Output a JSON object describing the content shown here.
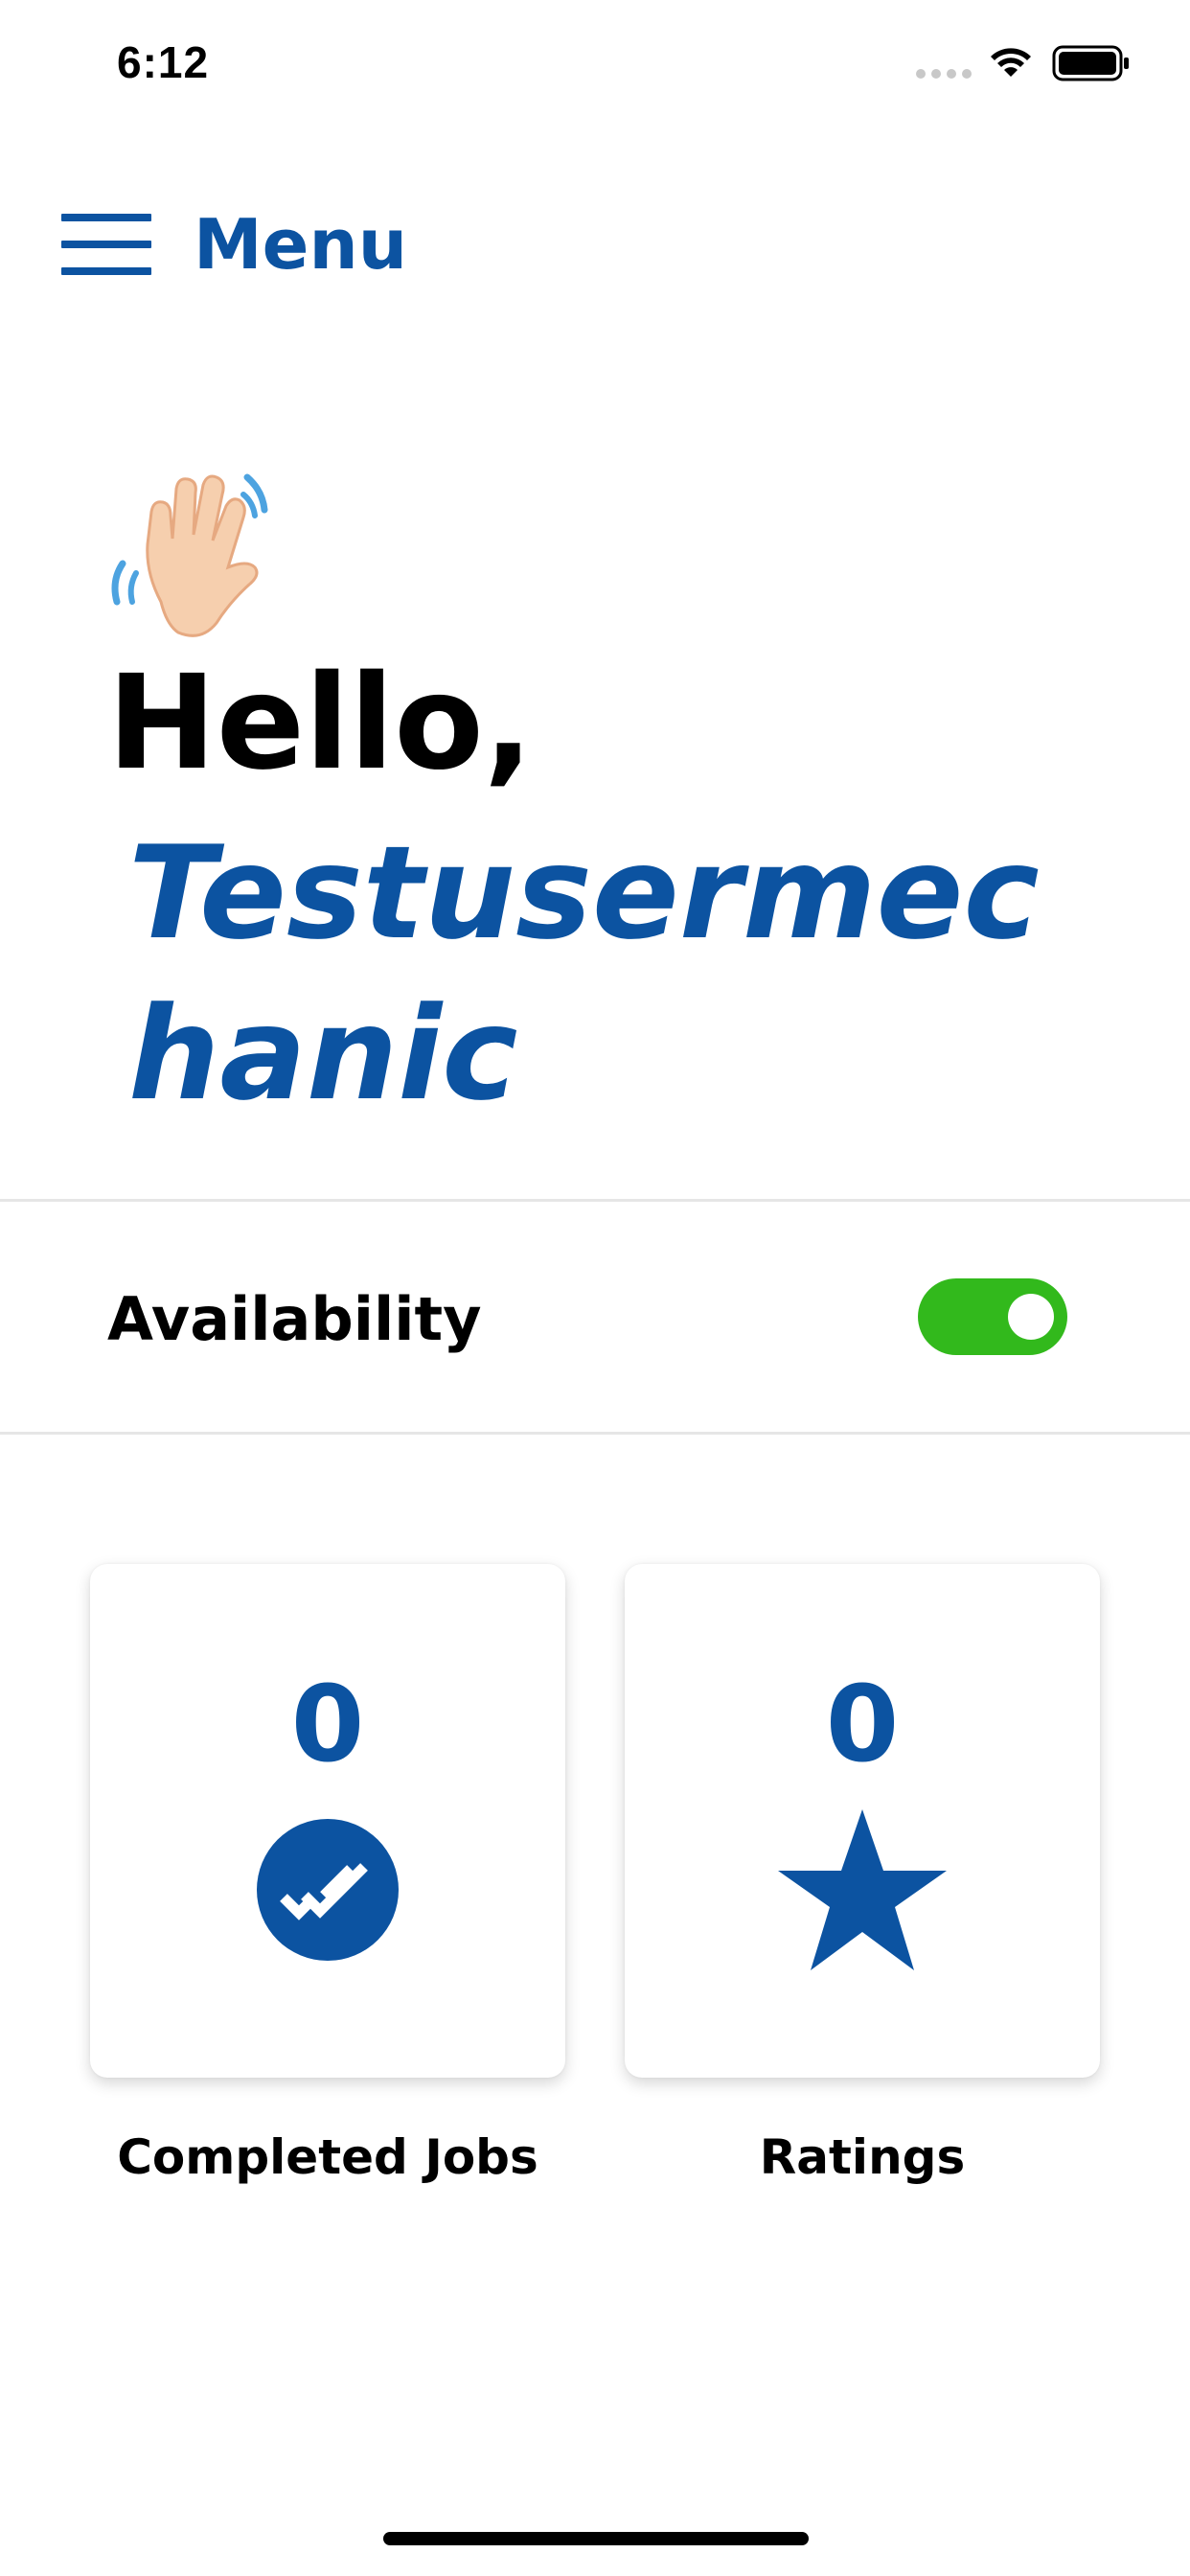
{
  "status_bar": {
    "time": "6:12"
  },
  "header": {
    "menu_label": "Menu",
    "menu_icon": "hamburger-icon"
  },
  "greeting": {
    "emoji_icon": "waving-hand-icon",
    "hello": "Hello,",
    "username": "Testusermechanic"
  },
  "availability": {
    "label": "Availability",
    "enabled": true
  },
  "stats": {
    "completed_jobs": {
      "value": "0",
      "label": "Completed Jobs",
      "icon": "double-check-icon"
    },
    "ratings": {
      "value": "0",
      "label": "Ratings",
      "icon": "star-icon"
    }
  },
  "colors": {
    "brand_blue": "#0c53a1",
    "toggle_green": "#32b91c"
  }
}
